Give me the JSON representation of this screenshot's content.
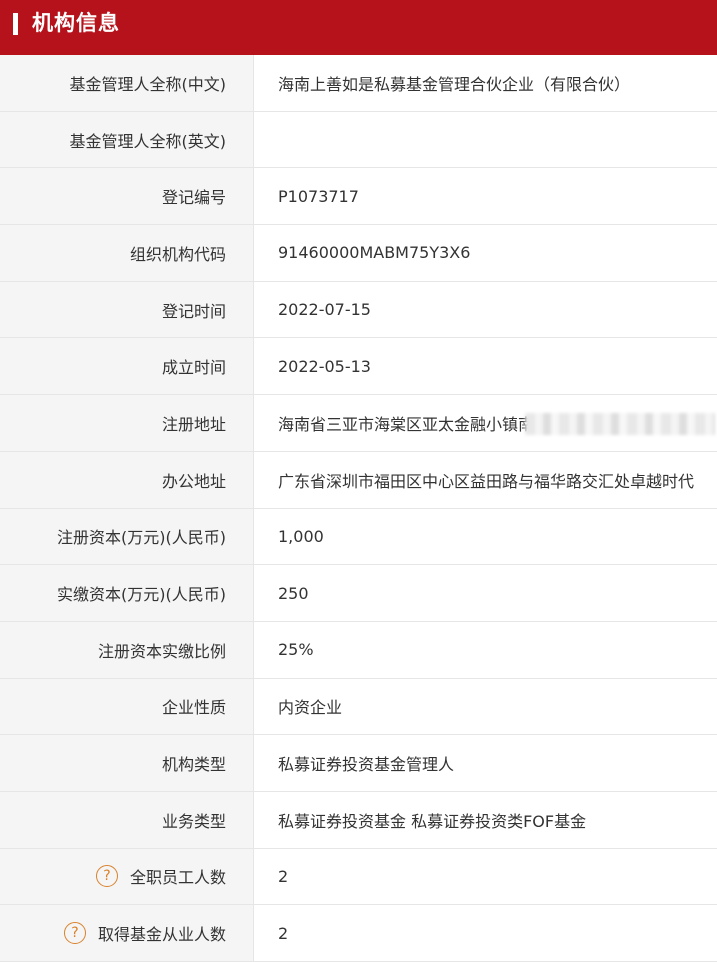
{
  "header": {
    "title": "机构信息"
  },
  "rows": [
    {
      "label": "基金管理人全称(中文)",
      "value": "海南上善如是私募基金管理合伙企业（有限合伙）"
    },
    {
      "label": "基金管理人全称(英文)",
      "value": ""
    },
    {
      "label": "登记编号",
      "value": "P1073717"
    },
    {
      "label": "组织机构代码",
      "value": "91460000MABM75Y3X6"
    },
    {
      "label": "登记时间",
      "value": "2022-07-15"
    },
    {
      "label": "成立时间",
      "value": "2022-05-13"
    },
    {
      "label": "注册地址",
      "value": "海南省三亚市海棠区亚太金融小镇南"
    },
    {
      "label": "办公地址",
      "value": "广东省深圳市福田区中心区益田路与福华路交汇处卓越时代"
    },
    {
      "label": "注册资本(万元)(人民币)",
      "value": "1,000"
    },
    {
      "label": "实缴资本(万元)(人民币)",
      "value": "250"
    },
    {
      "label": "注册资本实缴比例",
      "value": "25%"
    },
    {
      "label": "企业性质",
      "value": "内资企业"
    },
    {
      "label": "机构类型",
      "value": "私募证券投资基金管理人"
    },
    {
      "label": "业务类型",
      "value": "私募证券投资基金  私募证券投资类FOF基金"
    },
    {
      "label": "全职员工人数",
      "value": "2"
    },
    {
      "label": "取得基金从业人数",
      "value": "2"
    }
  ],
  "help_icon_glyph": "?",
  "colors": {
    "header_bg": "#b5121b",
    "label_bg": "#f5f5f5",
    "help_icon": "#d9822b",
    "text": "#333333"
  }
}
